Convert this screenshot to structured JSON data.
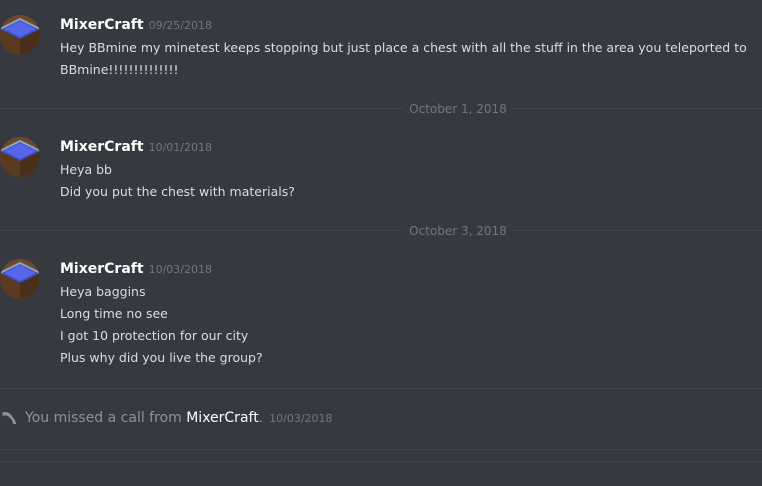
{
  "messages": [
    {
      "author": "MixerCraft",
      "timestamp": "09/25/2018",
      "lines": [
        "Hey BBmine my minetest keeps stopping but just place a chest with all the stuff in the area you teleported to",
        "BBmine!!!!!!!!!!!!!!"
      ]
    },
    {
      "author": "MixerCraft",
      "timestamp": "10/01/2018",
      "lines": [
        "Heya bb",
        "Did you put the chest with materials?"
      ]
    },
    {
      "author": "MixerCraft",
      "timestamp": "10/03/2018",
      "lines": [
        "Heya baggins",
        "Long time no see",
        "I got 10 protection for our city",
        "Plus why did you live the group?"
      ]
    }
  ],
  "dividers": [
    "October 1, 2018",
    "October 3, 2018"
  ],
  "call": {
    "prefix": "You missed a call from",
    "caller": "MixerCraft",
    "suffix": ".",
    "timestamp": "10/03/2018"
  },
  "colors": {
    "background": "#36393f",
    "username": "#ffffff",
    "text": "#dcddde",
    "muted": "#72767d"
  },
  "icons": {
    "avatar": "minetest-block-avatar",
    "call": "phone-icon"
  }
}
